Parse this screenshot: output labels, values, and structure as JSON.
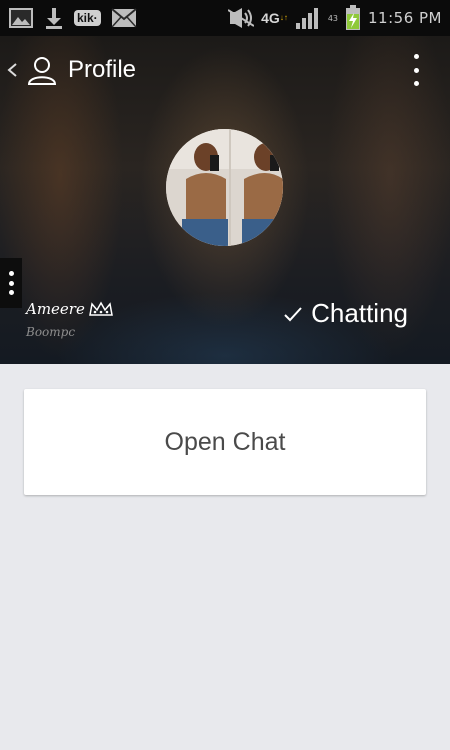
{
  "status_bar": {
    "time": "11:56 PM",
    "kik_label": "kik·",
    "network_label": "4G",
    "network_arrows": "↓↑",
    "battery_percent": "43",
    "icons": [
      "gallery-icon",
      "download-icon",
      "kik-icon",
      "mail-icon",
      "mute-icon",
      "signal-icon",
      "battery-charging-icon"
    ]
  },
  "header": {
    "title": "Profile",
    "back_icon": "chevron-left-icon",
    "profile_icon": "person-icon",
    "menu_icon": "more-vertical-icon"
  },
  "profile": {
    "display_name": "Ameere",
    "username": "Boompc",
    "status": "Chatting",
    "crown_icon": "crown-icon",
    "check_icon": "check-icon"
  },
  "actions": {
    "open_chat_label": "Open Chat"
  },
  "colors": {
    "status_bar_bg": "#0b0b0b",
    "content_bg": "#e8e9ed",
    "card_bg": "#ffffff",
    "text_primary": "#4a4a4a",
    "header_text": "#ffffff"
  }
}
